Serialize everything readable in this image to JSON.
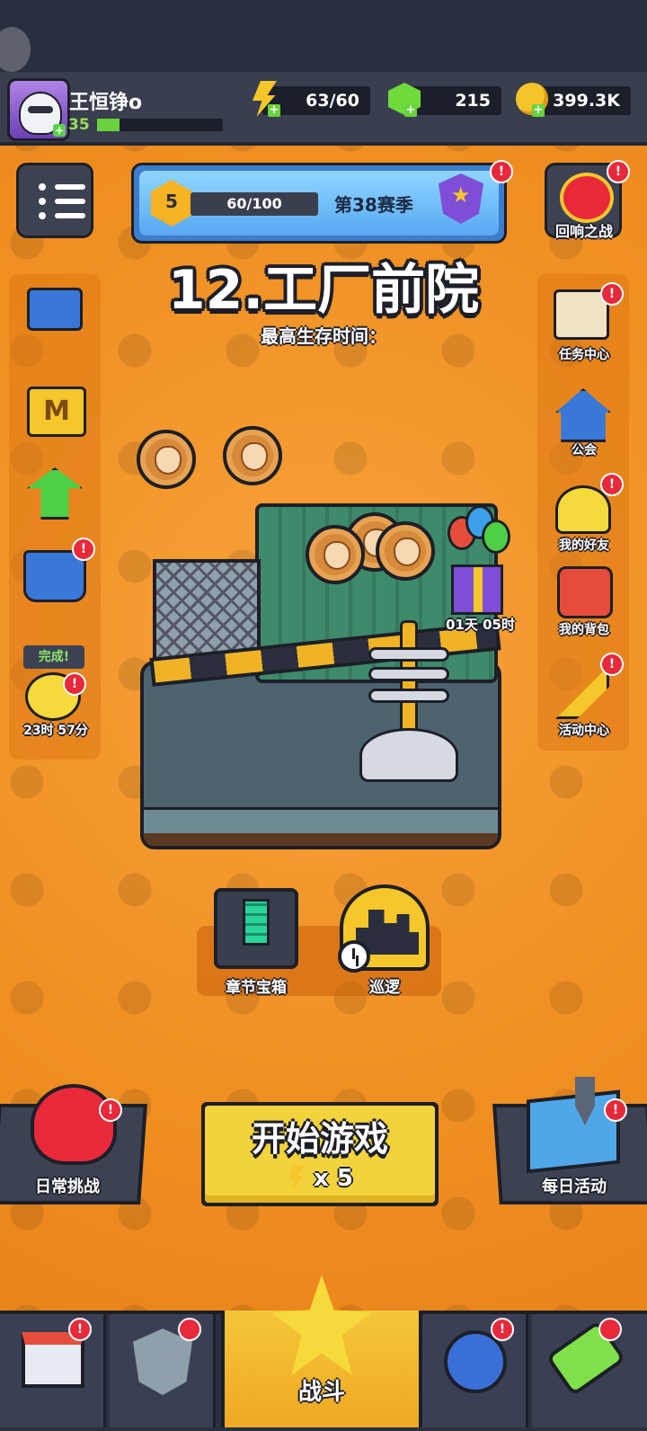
{
  "player": {
    "name": "王恒铮o",
    "level": "35",
    "xp_fraction": 0.18
  },
  "resources": {
    "energy": "63/60",
    "gems": "215",
    "coins": "399.3K"
  },
  "season": {
    "level": "5",
    "progress": "60/100",
    "title": "第38赛季"
  },
  "echo_battle": {
    "label": "回响之战"
  },
  "stage": {
    "title": "12.工厂前院",
    "survival_label": "最高生存时间："
  },
  "left_sidebar": {
    "items": [
      {
        "icon": "gift-coins-icon"
      },
      {
        "icon": "monthly-card-icon",
        "glyph": "M"
      },
      {
        "icon": "growth-arrow-icon"
      },
      {
        "icon": "shop-cart-icon"
      }
    ],
    "complete_badge": "完成!",
    "timer": "23时 57分"
  },
  "right_sidebar": {
    "items": [
      {
        "icon": "scroll-icon",
        "label": "任务中心"
      },
      {
        "icon": "guild-house-icon",
        "label": "公会"
      },
      {
        "icon": "friends-icon",
        "label": "我的好友"
      },
      {
        "icon": "backpack-icon",
        "label": "我的背包"
      },
      {
        "icon": "party-horn-icon",
        "label": "活动中心"
      }
    ]
  },
  "event": {
    "timer": "01天 05时"
  },
  "chapter": {
    "chest_label": "章节宝箱",
    "patrol_label": "巡逻"
  },
  "actions": {
    "daily_challenge": "日常挑战",
    "start_game": "开始游戏",
    "start_cost": "x 5",
    "daily_event": "每日活动"
  },
  "nav": {
    "battle_label": "战斗"
  },
  "alert_glyph": "!",
  "colors": {
    "accent_orange": "#f08f22",
    "alert_red": "#e8293a",
    "start_yellow": "#f3d33b",
    "dark_panel": "#3d4252"
  }
}
